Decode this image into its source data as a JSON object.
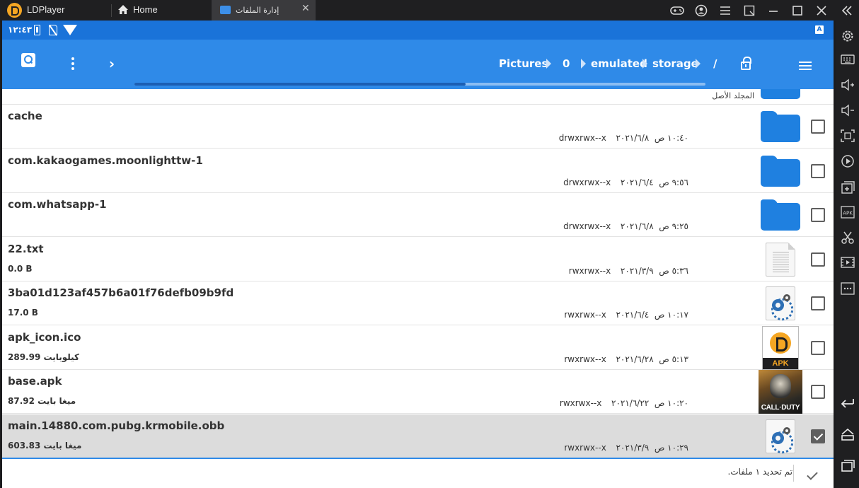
{
  "titlebar": {
    "app_name": "LDPlayer",
    "home_tab": "Home",
    "active_tab": "إدارة الملفات"
  },
  "statusbar": {
    "time": "١٢:٤٣",
    "keyboard_indicator": "A"
  },
  "actionbar": {
    "breadcrumb": [
      "Pictures",
      "0",
      "emulated",
      "storage",
      "/"
    ],
    "progress": 0.58
  },
  "filelist": {
    "parent_label": "المجلد الأصل",
    "rows": [
      {
        "name": "cache",
        "size": "",
        "date": "٢٠٢١/٦/٨",
        "time": "١٠:٤٠ ص",
        "perm": "drwxrwx--x",
        "icon": "folder-icon",
        "checked": false
      },
      {
        "name": "com.kakaogames.moonlighttw-1",
        "size": "",
        "date": "٢٠٢١/٦/٤",
        "time": "٩:٥٦ ص",
        "perm": "drwxrwx--x",
        "icon": "folder-icon",
        "checked": false
      },
      {
        "name": "com.whatsapp-1",
        "size": "",
        "date": "٢٠٢١/٦/٨",
        "time": "٩:٢٥ ص",
        "perm": "drwxrwx--x",
        "icon": "folder-icon",
        "checked": false
      },
      {
        "name": "22.txt",
        "size": "0.0 B",
        "date": "٢٠٢١/٣/٩",
        "time": "٥:٣٦ ص",
        "perm": "rwxrwx--x",
        "icon": "text-file-icon",
        "checked": false
      },
      {
        "name": "3ba01d123af457b6a01f76defb09b9fd",
        "size": "17.0 B",
        "date": "٢٠٢١/٦/٤",
        "time": "١٠:١٧ ص",
        "perm": "rwxrwx--x",
        "icon": "config-file-icon",
        "checked": false
      },
      {
        "name": "apk_icon.ico",
        "size": "289.99 كيلوبايت",
        "date": "٢٠٢١/٦/٢٨",
        "time": "٥:١٣ ص",
        "perm": "rwxrwx--x",
        "icon": "apk-logo-icon",
        "checked": false
      },
      {
        "name": "base.apk",
        "size": "87.92 ميغا بايت",
        "date": "٢٠٢١/٦/٢٢",
        "time": "١٠:٢٠ ص",
        "perm": "rwxrwx--x",
        "icon": "call-of-duty-icon",
        "checked": false
      },
      {
        "name": "main.14880.com.pubg.krmobile.obb",
        "size": "603.83 ميغا بايت",
        "date": "٢٠٢١/٣/٩",
        "time": "١٠:٢٩ ص",
        "perm": "rwxrwx--x",
        "icon": "config-file-icon",
        "checked": true
      }
    ],
    "apk_badge": "APK",
    "cod_title": "CALL·DUTY"
  },
  "bottombar": {
    "selection_text": "تم تحديد ١ ملفات."
  },
  "colors": {
    "accent": "#2f8ae8",
    "statusbar": "#1a73d9",
    "folder": "#1f80e0",
    "ldplayer_brand": "#f5a623"
  }
}
